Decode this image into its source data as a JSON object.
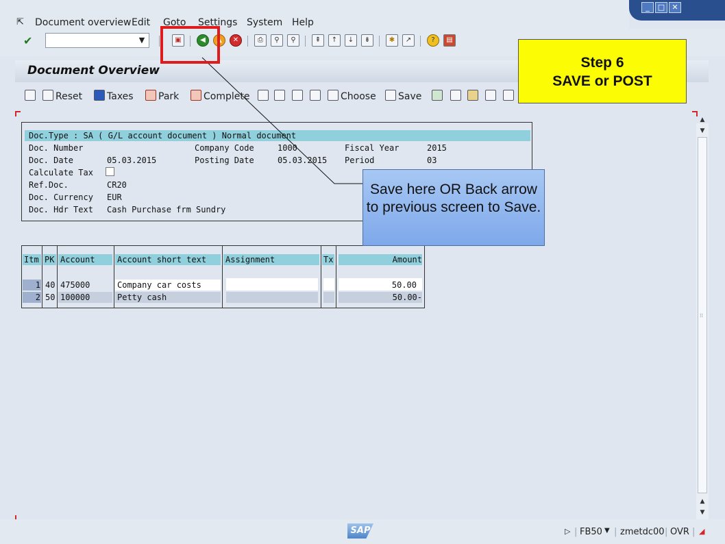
{
  "menu": {
    "items": [
      "Document overview",
      "Edit",
      "Goto",
      "Settings",
      "System",
      "Help"
    ]
  },
  "toolbar": {
    "command_value": "",
    "icons": [
      "enter-icon",
      "save-icon",
      "back-icon",
      "exit-icon",
      "cancel-icon",
      "print-icon",
      "find-icon",
      "find-next-icon",
      "first-page-icon",
      "previous-page-icon",
      "next-page-icon",
      "last-page-icon",
      "create-session-icon",
      "shortcut-icon",
      "help-icon",
      "layout-icon"
    ]
  },
  "title": "Document Overview",
  "app_toolbar": {
    "reset": "Reset",
    "taxes": "Taxes",
    "park": "Park",
    "complete": "Complete",
    "choose": "Choose",
    "save": "Save"
  },
  "header": {
    "doc_type": "Doc.Type : SA ( G/L account document ) Normal document",
    "doc_number_label": "Doc. Number",
    "doc_number": "",
    "company_code_label": "Company Code",
    "company_code": "1000",
    "fiscal_year_label": "Fiscal Year",
    "fiscal_year": "2015",
    "doc_date_label": "Doc. Date",
    "doc_date": "05.03.2015",
    "posting_date_label": "Posting Date",
    "posting_date": "05.03.2015",
    "period_label": "Period",
    "period": "03",
    "calculate_tax_label": "Calculate Tax",
    "ref_doc_label": "Ref.Doc.",
    "ref_doc": "CR20",
    "currency_label": "Doc. Currency",
    "currency": "EUR",
    "hdr_text_label": "Doc. Hdr Text",
    "hdr_text": "Cash Purchase frm Sundry"
  },
  "table": {
    "columns": [
      "Itm",
      "PK",
      "Account",
      "Account short text",
      "Assignment",
      "Tx",
      "Amount"
    ],
    "rows": [
      {
        "itm": "1",
        "pk": "40",
        "account": "475000",
        "text": "Company car costs",
        "assignment": "",
        "tx": "",
        "amount": "50.00"
      },
      {
        "itm": "2",
        "pk": "50",
        "account": "100000",
        "text": "Petty cash",
        "assignment": "",
        "tx": "",
        "amount": "50.00-"
      }
    ]
  },
  "annotations": {
    "step_line1": "Step 6",
    "step_line2": "SAVE or POST",
    "callout": "Save here OR Back arrow to previous screen to Save."
  },
  "status": {
    "transaction": "FB50",
    "user": "zmetdc00",
    "mode": "OVR",
    "logo": "SAP"
  }
}
